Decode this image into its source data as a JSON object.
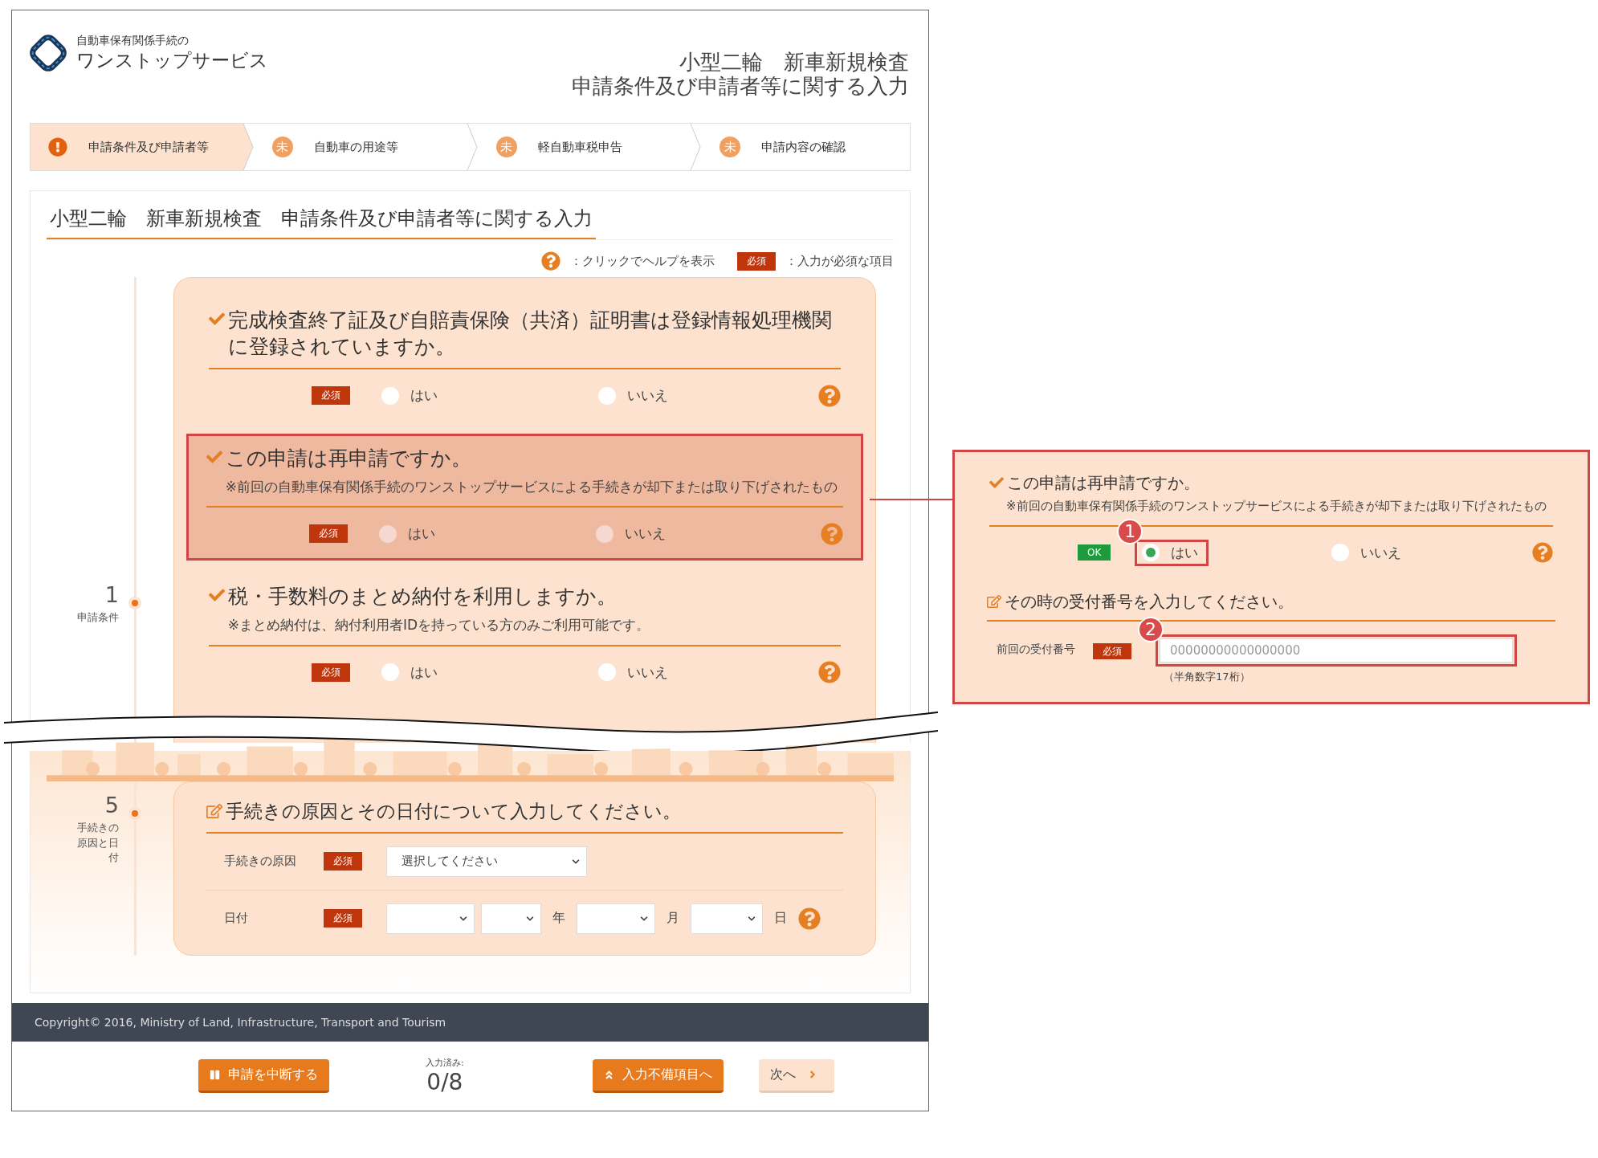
{
  "header": {
    "logo_caption": "自動車保有関係手続の",
    "logo_name": "ワンストップサービス",
    "title_lines": [
      "小型二輪　新車新規検査",
      "申請条件及び申請者等に関する入力"
    ]
  },
  "steps": [
    {
      "kind": "error",
      "label": "申請条件及び申請者等",
      "selected": true
    },
    {
      "kind": "pending",
      "mark": "未",
      "label": "自動車の用途等",
      "selected": false
    },
    {
      "kind": "pending",
      "mark": "未",
      "label": "軽自動車税申告",
      "selected": false
    },
    {
      "kind": "pending",
      "mark": "未",
      "label": "申請内容の確認",
      "selected": false
    }
  ],
  "page_heading": "小型二輪　新車新規検査　申請条件及び申請者等に関する入力",
  "legend": {
    "help_text": "：クリックでヘルプを表示",
    "required_badge": "必須",
    "required_text": "：入力が必須な項目"
  },
  "section_1": {
    "number": "1",
    "label": "申請条件",
    "questions": [
      {
        "kind": "choice",
        "title": "完成検査終了証及び自賠責保険（共済）証明書は登録情報処理機関に登録されていますか。",
        "badge": {
          "kind": "required",
          "text": "必須"
        },
        "highlighted": false,
        "options": [
          {
            "label": "はい",
            "selected": false
          },
          {
            "label": "いいえ",
            "selected": false
          }
        ]
      },
      {
        "kind": "choice",
        "title": "この申請は再申請ですか。",
        "note": "※前回の自動車保有関係手続のワンストップサービスによる手続きが却下または取り下げされたもの",
        "badge": {
          "kind": "required",
          "text": "必須"
        },
        "highlighted": true,
        "options": [
          {
            "label": "はい",
            "selected": false
          },
          {
            "label": "いいえ",
            "selected": false
          }
        ]
      },
      {
        "kind": "choice",
        "title": "税・手数料のまとめ納付を利用しますか。",
        "note": "※まとめ納付は、納付利用者IDを持っている方のみご利用可能です。",
        "badge": {
          "kind": "required",
          "text": "必須"
        },
        "highlighted": false,
        "options": [
          {
            "label": "はい",
            "selected": false
          },
          {
            "label": "いいえ",
            "selected": false
          }
        ]
      }
    ]
  },
  "section_5": {
    "number": "5",
    "label": "手続きの原因と日付",
    "kind": "input",
    "title": "手続きの原因とその日付について入力してください。",
    "fields": [
      {
        "kind": "select",
        "label": "手続きの原因",
        "badge": {
          "kind": "required",
          "text": "必須"
        },
        "value": "選択してください"
      },
      {
        "kind": "date",
        "label": "日付",
        "badge": {
          "kind": "required",
          "text": "必須"
        },
        "units": [
          "年",
          "月",
          "日"
        ]
      }
    ]
  },
  "copyright": "Copyright© 2016, Ministry of Land, Infrastructure, Transport and Tourism",
  "bottom_bar": {
    "suspend_button": "申請を中断する",
    "progress_label": "入力済み:",
    "progress_value": "0/8",
    "incomplete_button": "入力不備項目へ",
    "next_button": "次へ"
  },
  "callout": {
    "question": {
      "kind": "choice",
      "title": "この申請は再申請ですか。",
      "note": "※前回の自動車保有関係手続のワンストップサービスによる手続きが却下または取り下げされたもの",
      "badge": {
        "kind": "ok",
        "text": "OK"
      },
      "highlighted": false,
      "marker": "1",
      "options": [
        {
          "label": "はい",
          "selected": true
        },
        {
          "label": "いいえ",
          "selected": false
        }
      ]
    },
    "sub_question": {
      "kind": "input",
      "title": "その時の受付番号を入力してください。",
      "field_label": "前回の受付番号",
      "badge": {
        "kind": "required",
        "text": "必須"
      },
      "marker": "2",
      "placeholder": "00000000000000000",
      "hint": "（半角数字17桁）"
    }
  }
}
